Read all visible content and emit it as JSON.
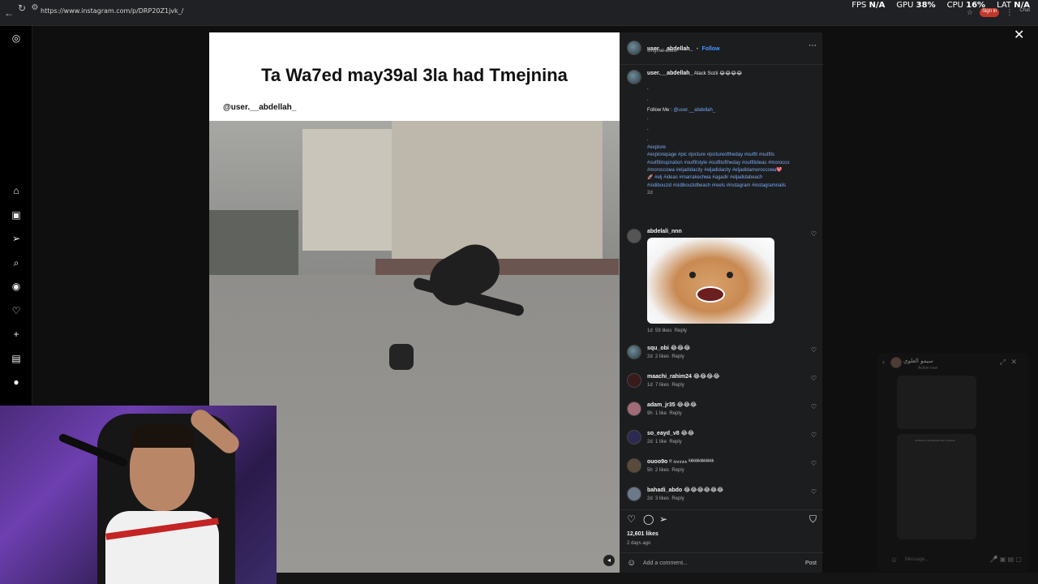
{
  "browser": {
    "url": "https://www.instagram.com/p/DRP20Z1jvk_/",
    "stats": {
      "fps_label": "FPS",
      "fps_value": "N/A",
      "gpu_label": "GPU",
      "gpu_value": "38%",
      "cpu_label": "CPU",
      "cpu_value": "16%",
      "lat_label": "LAT",
      "lat_value": "N/A"
    },
    "signin_label": "Sign in",
    "chat_label": "Chat"
  },
  "post": {
    "author": "user.__abdellah_",
    "follow_label": "Follow",
    "audio": "Original audio",
    "media_title": "Ta Wa7ed may39al 3la had Tmejnina",
    "media_handle": "@user.__abdellah_",
    "caption": {
      "author": "user.__abdellah_",
      "text": "Atack Sozii 😂😂😂😂",
      "dots": [
        ".",
        ".",
        ".",
        ".",
        "."
      ],
      "follow_prefix": "Follow Me :",
      "follow_handle": "@user.__abdellah_",
      "hashtags_line1": "#explore",
      "hashtags_line2": "#explorepage #pic #picture #pictureoftheday #outfit #outfits",
      "hashtags_line3": "#outfitinspiration #outfitstyle #outfitoftheday #outfitideas #morocco",
      "hashtags_line4": "#moroccoмa #eljadidacity #eljadidacity #eljadidamoroccoмa💖",
      "hashtags_line5": "🚀 #elj #ideas #marrakechмa #agadir #eljadidabeach",
      "hashtags_line6": "#sidibouzid #sidibouzidbeach #reels #instagram #instagramnails",
      "time": "2d"
    },
    "comments": [
      {
        "user": "abdelali_nnn",
        "text": "",
        "time": "1d",
        "likes": "59 likes",
        "reply": "Reply"
      },
      {
        "user": "squ_obi",
        "text": "😂😂😂",
        "time": "2d",
        "likes": "2 likes",
        "reply": "Reply"
      },
      {
        "user": "maachi_rahim24",
        "text": "😂😂😂😂",
        "time": "1d",
        "likes": "7 likes",
        "reply": "Reply"
      },
      {
        "user": "adam_jr35",
        "text": "😂😂😂",
        "time": "9h",
        "likes": "1 like",
        "reply": "Reply"
      },
      {
        "user": "so_eayd_v8",
        "text": "😂😂",
        "time": "2d",
        "likes": "1 like",
        "reply": "Reply"
      },
      {
        "user": "ouoo9o",
        "text": "ᵎᵎᵎ ₕₕₕₕₕₕ ᵏᵏᵏᵏᵏᵏᵏᵏᵏᵏᵏᵏᵏ",
        "time": "5h",
        "likes": "2 likes",
        "reply": "Reply"
      },
      {
        "user": "bahadi_abdo",
        "text": "😂😂😂😂😂😂",
        "time": "2d",
        "likes": "3 likes",
        "reply": "Reply"
      }
    ],
    "likes_count": "12,601 likes",
    "posted_ago": "2 days ago",
    "add_comment_placeholder": "Add a comment...",
    "post_label": "Post"
  },
  "chat_popup": {
    "name": "سيمو العلوي",
    "status": "Active now",
    "message_placeholder": "Message...",
    "shared_caption": "Ta Wa7ed may39al 3la had Tmejnina"
  },
  "icons": {
    "instagram": "instagram-icon",
    "home": "home-icon",
    "reels": "reels-icon",
    "send": "send-icon",
    "search": "search-icon",
    "explore": "explore-icon",
    "heart": "heart-icon",
    "create": "plus-icon",
    "dashboard": "dashboard-icon",
    "profile": "profile-icon"
  }
}
